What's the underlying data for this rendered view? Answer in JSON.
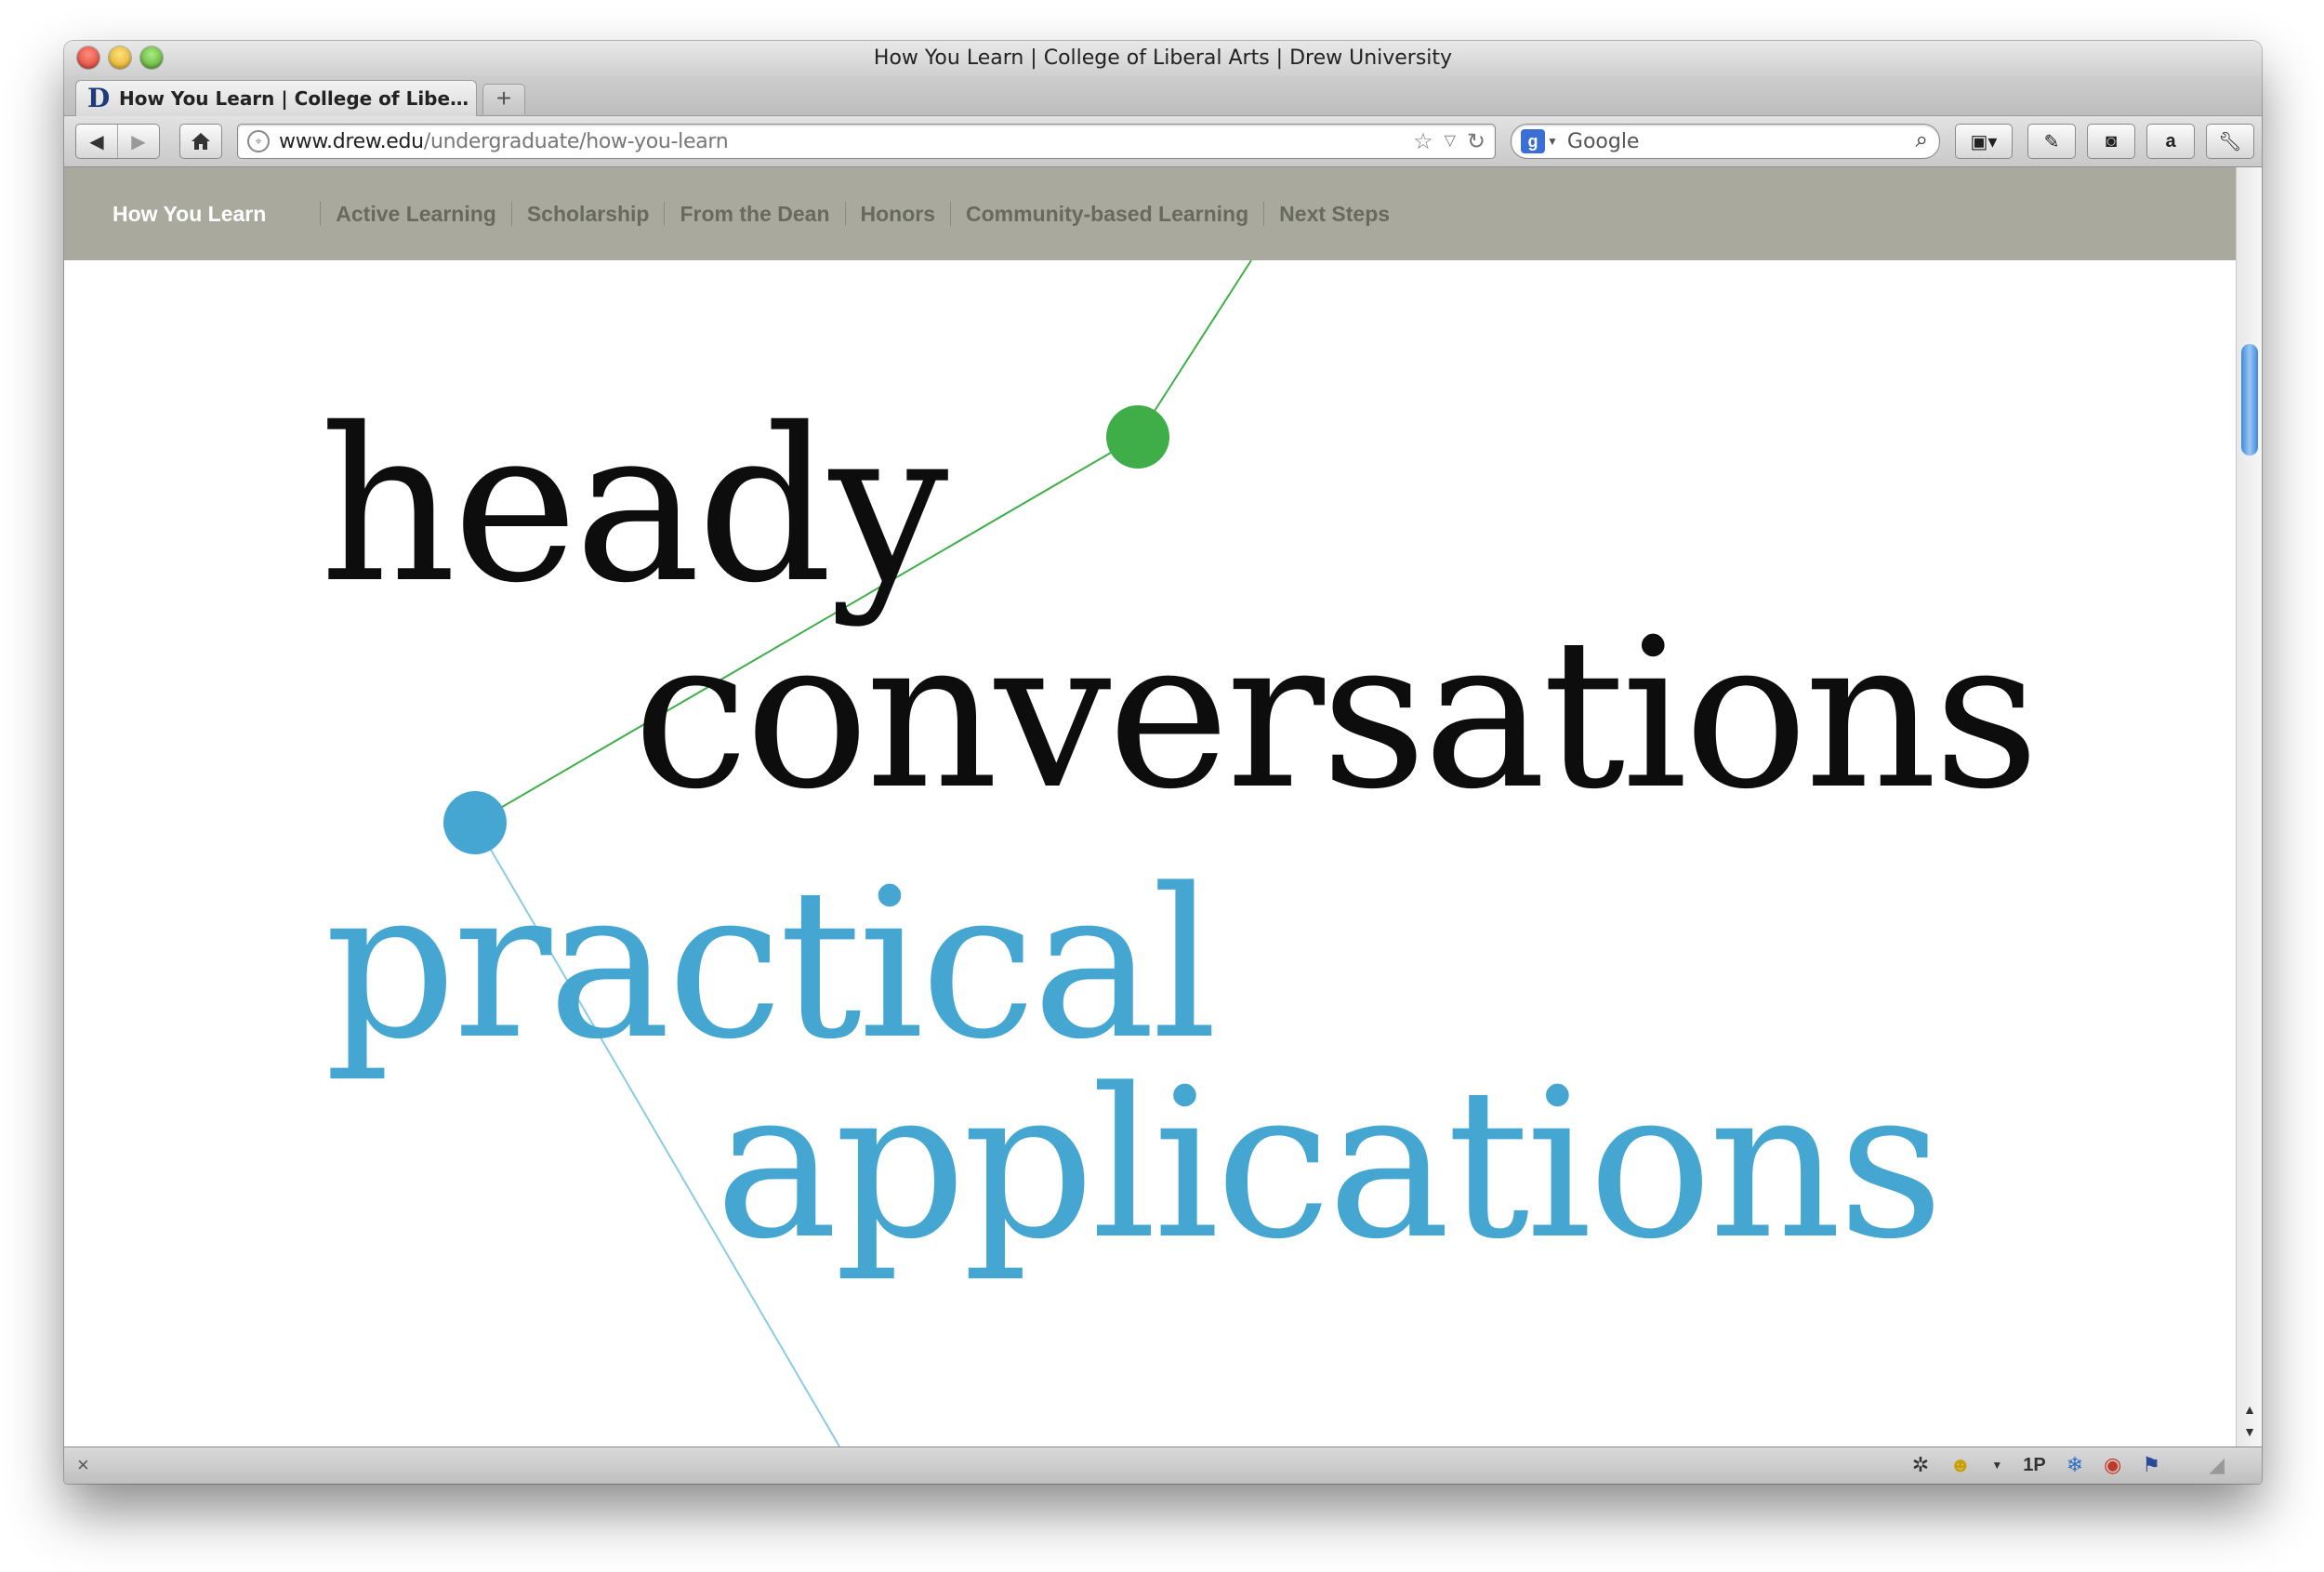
{
  "window": {
    "title": "How You Learn | College of Liberal Arts | Drew University"
  },
  "tab": {
    "favicon_text": "D",
    "label": "How You Learn | College of Libe…",
    "new_tab_symbol": "+"
  },
  "toolbar": {
    "back_icon": "back-arrow-icon",
    "forward_icon": "forward-arrow-icon",
    "home_icon": "home-icon",
    "url_domain": "www.drew.edu",
    "url_path": "/undergraduate/how-you-learn",
    "search_provider_letter": "g",
    "search_placeholder": "Google"
  },
  "site_nav": {
    "current": "How You Learn",
    "items": [
      "Active Learning",
      "Scholarship",
      "From the Dean",
      "Honors",
      "Community-based Learning",
      "Next Steps"
    ]
  },
  "hero": {
    "line1": "heady",
    "line2": "conversations",
    "line3": "practical",
    "line4": "applications"
  },
  "status_bar": {
    "close_symbol": "×",
    "addon_1p": "1P"
  },
  "colors": {
    "nav_bg": "#a9aa9d",
    "green_dot": "#3fae49",
    "blue_dot": "#46a6d2",
    "blue_text": "#46a6d2"
  }
}
